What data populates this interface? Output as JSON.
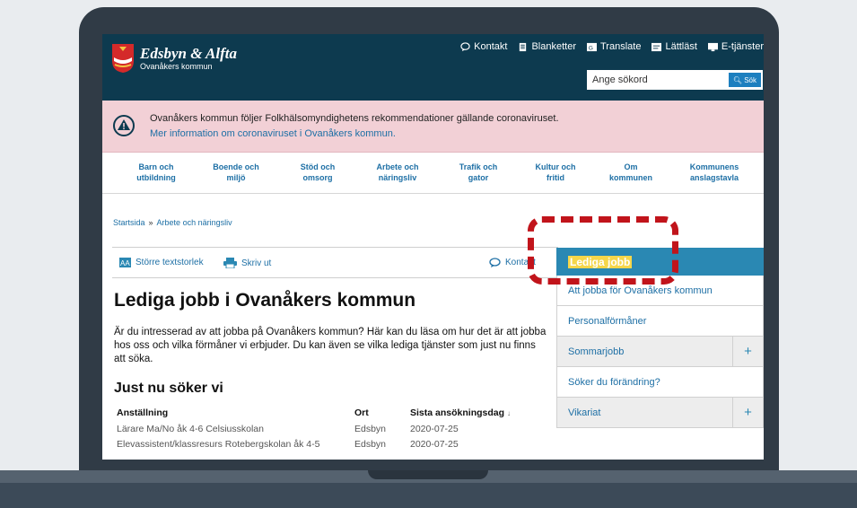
{
  "header": {
    "logo_name": "Edsbyn & Alfta",
    "logo_sub": "Ovanåkers kommun",
    "top_links": [
      {
        "label": "Kontakt",
        "icon": "chat-bubble-icon"
      },
      {
        "label": "Blanketter",
        "icon": "document-icon"
      },
      {
        "label": "Translate",
        "icon": "translate-icon"
      },
      {
        "label": "Lättläst",
        "icon": "easy-read-icon"
      },
      {
        "label": "E-tjänster",
        "icon": "monitor-icon"
      }
    ],
    "search_placeholder": "Ange sökord",
    "search_button": "Sök"
  },
  "alert": {
    "text": "Ovanåkers kommun följer Folkhälsomyndighetens rekommendationer gällande coronaviruset.",
    "link": "Mer information om coronaviruset i Ovanåkers kommun."
  },
  "nav": [
    {
      "line1": "Barn och",
      "line2": "utbildning"
    },
    {
      "line1": "Boende och",
      "line2": "miljö"
    },
    {
      "line1": "Stöd och",
      "line2": "omsorg"
    },
    {
      "line1": "Arbete och",
      "line2": "näringsliv"
    },
    {
      "line1": "Trafik och",
      "line2": "gator"
    },
    {
      "line1": "Kultur och",
      "line2": "fritid"
    },
    {
      "line1": "Om",
      "line2": "kommunen"
    },
    {
      "line1": "Kommunens",
      "line2": "anslagstavla"
    }
  ],
  "breadcrumb": {
    "home": "Startsida",
    "sep": "»",
    "current": "Arbete och näringsliv"
  },
  "tools": {
    "textsize": "Större textstorlek",
    "print": "Skriv ut",
    "contact": "Kontakt"
  },
  "main": {
    "title": "Lediga jobb i Ovanåkers kommun",
    "intro": "Är du intresserad av att jobba på Ovanåkers kommun? Här kan du läsa om hur det är att jobba hos oss och vilka förmåner vi erbjuder. Du kan även se vilka lediga tjänster som just nu finns att söka.",
    "subheading": "Just nu söker vi",
    "table": {
      "headers": [
        "Anställning",
        "Ort",
        "Sista ansökningsdag"
      ],
      "rows": [
        [
          "Lärare Ma/No åk 4-6 Celsiusskolan",
          "Edsbyn",
          "2020-07-25"
        ],
        [
          "Elevassistent/klassresurs Rotebergskolan åk 4-5",
          "Edsbyn",
          "2020-07-25"
        ]
      ]
    }
  },
  "sidemenu": {
    "active": "Lediga jobb",
    "items": [
      {
        "label": "Att jobba för Ovanåkers kommun",
        "expandable": false
      },
      {
        "label": "Personalförmåner",
        "expandable": false
      },
      {
        "label": "Sommarjobb",
        "expandable": true
      },
      {
        "label": "Söker du förändring?",
        "expandable": false
      },
      {
        "label": "Vikariat",
        "expandable": true
      }
    ],
    "plus": "+"
  },
  "colors": {
    "header_bg": "#0d3a4f",
    "alert_bg": "#f2d0d6",
    "link": "#1d6fa5",
    "side_active": "#2a88b3",
    "highlight": "#c1141b"
  }
}
